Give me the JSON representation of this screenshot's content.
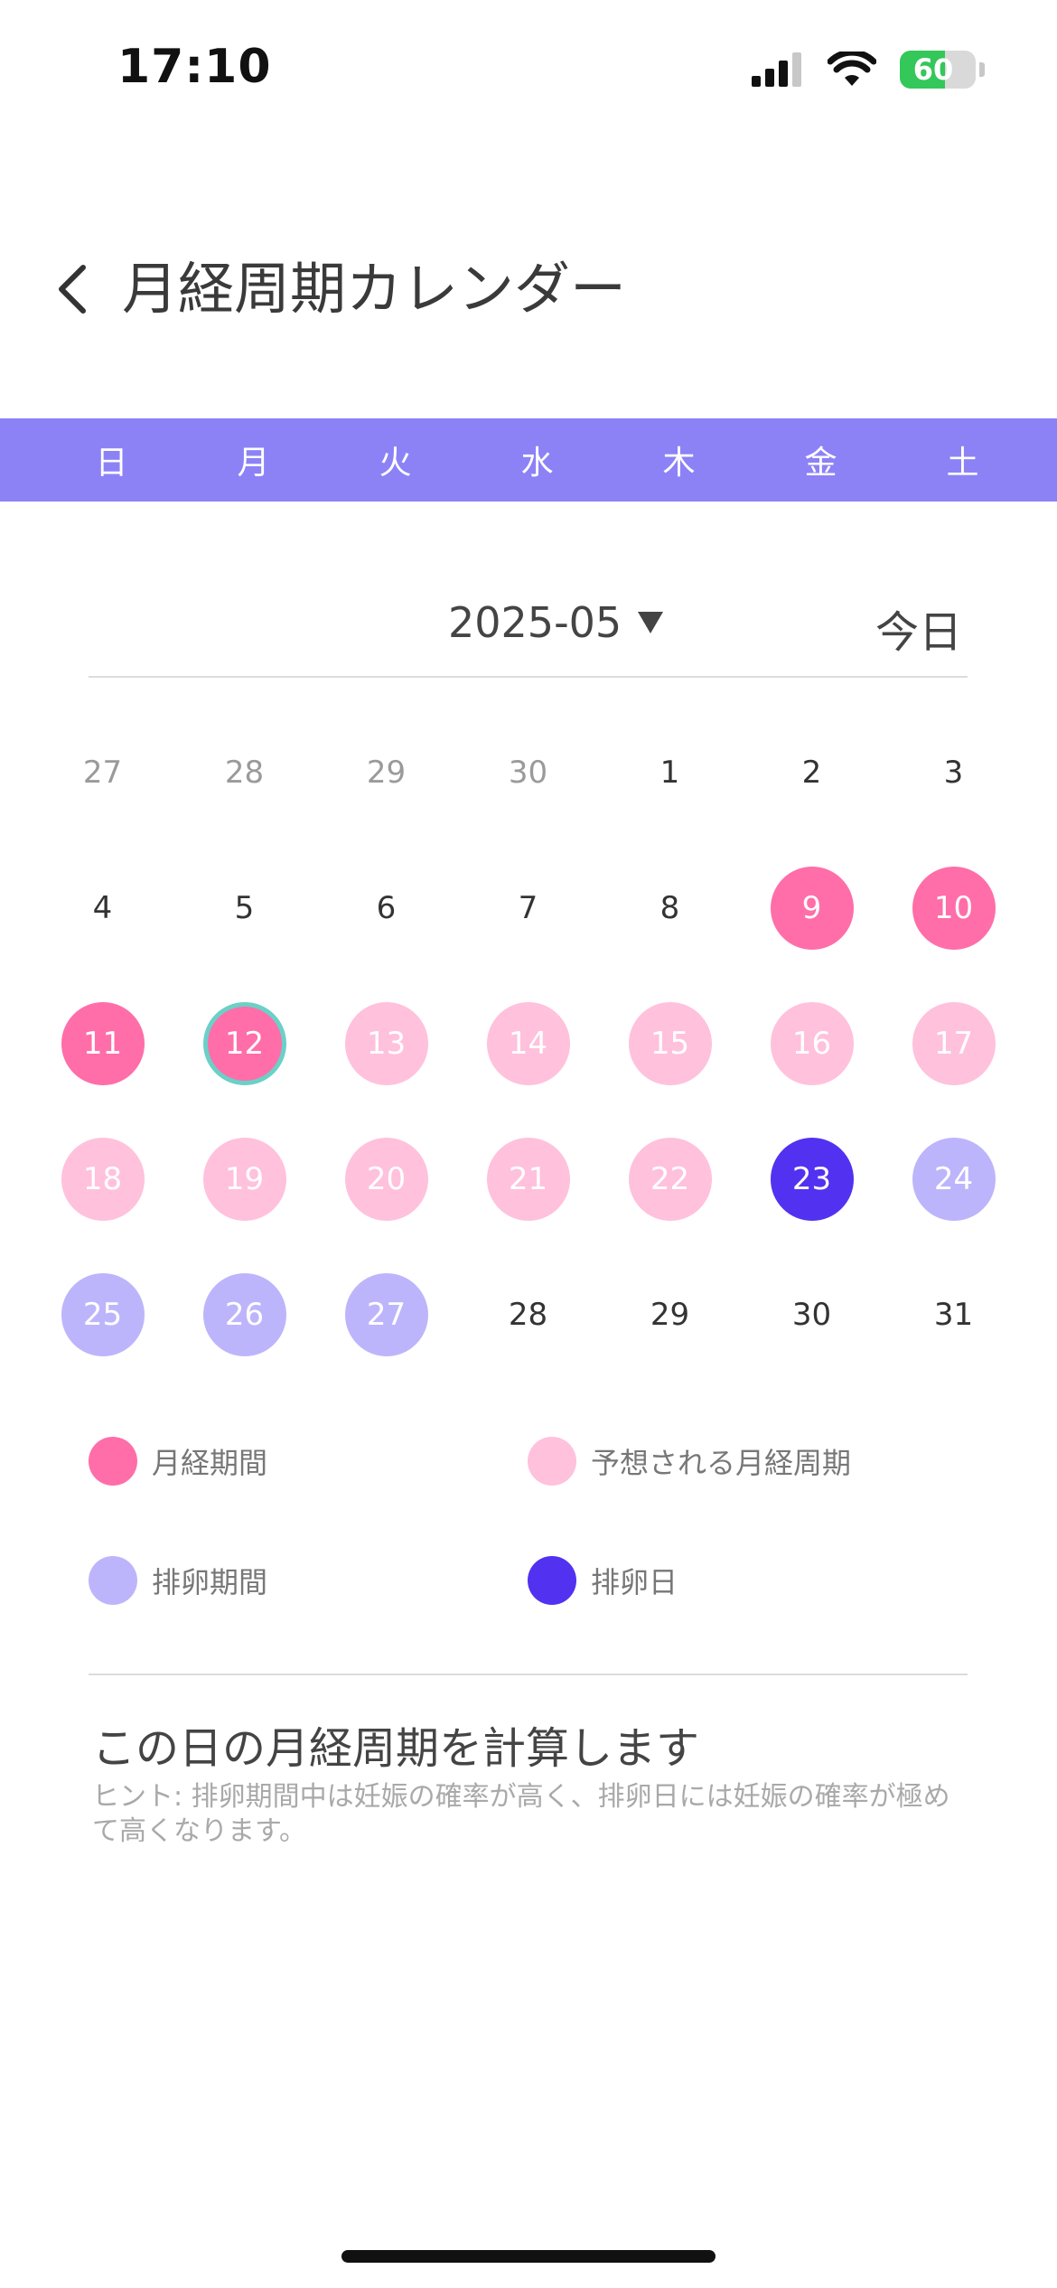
{
  "status_bar": {
    "time": "17:10",
    "battery": "60",
    "battery_level": 0.6
  },
  "header": {
    "title": "月経周期カレンダー",
    "back_icon": "chevron-left-icon"
  },
  "weekdays": [
    "日",
    "月",
    "火",
    "水",
    "木",
    "金",
    "土"
  ],
  "month_selector": {
    "month": "2025-05",
    "today_label": "今日"
  },
  "calendar": {
    "days": [
      {
        "label": "27",
        "state": "other"
      },
      {
        "label": "28",
        "state": "other"
      },
      {
        "label": "29",
        "state": "other"
      },
      {
        "label": "30",
        "state": "other"
      },
      {
        "label": "1",
        "state": "normal"
      },
      {
        "label": "2",
        "state": "normal"
      },
      {
        "label": "3",
        "state": "normal"
      },
      {
        "label": "4",
        "state": "normal"
      },
      {
        "label": "5",
        "state": "normal"
      },
      {
        "label": "6",
        "state": "normal"
      },
      {
        "label": "7",
        "state": "normal"
      },
      {
        "label": "8",
        "state": "normal"
      },
      {
        "label": "9",
        "state": "period"
      },
      {
        "label": "10",
        "state": "period"
      },
      {
        "label": "11",
        "state": "period"
      },
      {
        "label": "12",
        "state": "period",
        "selected": true
      },
      {
        "label": "13",
        "state": "predicted"
      },
      {
        "label": "14",
        "state": "predicted"
      },
      {
        "label": "15",
        "state": "predicted"
      },
      {
        "label": "16",
        "state": "predicted"
      },
      {
        "label": "17",
        "state": "predicted"
      },
      {
        "label": "18",
        "state": "predicted"
      },
      {
        "label": "19",
        "state": "predicted"
      },
      {
        "label": "20",
        "state": "predicted"
      },
      {
        "label": "21",
        "state": "predicted"
      },
      {
        "label": "22",
        "state": "predicted"
      },
      {
        "label": "23",
        "state": "ovulation-day"
      },
      {
        "label": "24",
        "state": "ovulation-period"
      },
      {
        "label": "25",
        "state": "ovulation-period"
      },
      {
        "label": "26",
        "state": "ovulation-period"
      },
      {
        "label": "27",
        "state": "ovulation-period"
      },
      {
        "label": "28",
        "state": "normal"
      },
      {
        "label": "29",
        "state": "normal"
      },
      {
        "label": "30",
        "state": "normal"
      },
      {
        "label": "31",
        "state": "normal"
      }
    ]
  },
  "legend": {
    "period": {
      "label": "月経期間",
      "color": "#ff6ea8"
    },
    "predicted": {
      "label": "予想される月経周期",
      "color": "#ffc1dc"
    },
    "ovulation_period": {
      "label": "排卵期間",
      "color": "#bdb5fb"
    },
    "ovulation_day": {
      "label": "排卵日",
      "color": "#5232f0"
    }
  },
  "info": {
    "title": "この日の月経周期を計算します",
    "hint": "ヒント: 排卵期間中は妊娠の確率が高く、排卵日には妊娠の確率が極めて高くなります。"
  },
  "colors": {
    "accent": "#8c82f6",
    "selected_ring": "#6bd0c8"
  }
}
